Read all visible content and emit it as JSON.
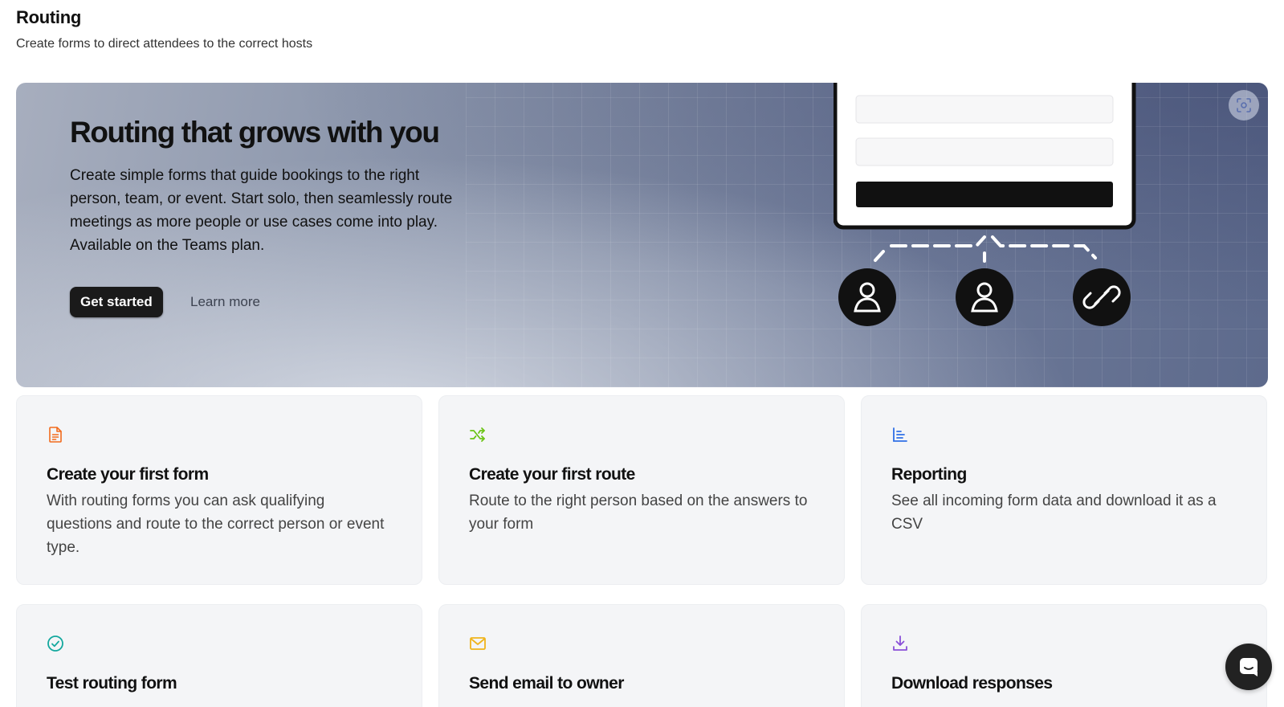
{
  "header": {
    "title": "Routing",
    "subtitle": "Create forms to direct attendees to the correct hosts"
  },
  "hero": {
    "title": "Routing that grows with you",
    "description": "Create simple forms that guide bookings to the right person, team, or event. Start solo, then seamlessly route meetings as more people or use cases come into play. Available on the Teams plan.",
    "primary_button": "Get started",
    "secondary_link": "Learn more",
    "expand_icon": "focus-expand-icon",
    "illustration_icons": [
      "user-icon",
      "user-icon",
      "link-icon"
    ]
  },
  "cards": [
    {
      "icon": "document-icon",
      "icon_color": "#f26b1d",
      "title": "Create your first form",
      "description": "With routing forms you can ask qualifying questions and route to the correct person or event type."
    },
    {
      "icon": "shuffle-icon",
      "icon_color": "#6cc417",
      "title": "Create your first route",
      "description": "Route to the right person based on the answers to your form"
    },
    {
      "icon": "bar-chart-icon",
      "icon_color": "#2f6fe6",
      "title": "Reporting",
      "description": "See all incoming form data and download it as a CSV"
    },
    {
      "icon": "check-circle-icon",
      "icon_color": "#13a89e",
      "title": "Test routing form",
      "description": ""
    },
    {
      "icon": "mail-icon",
      "icon_color": "#f0b41c",
      "title": "Send email to owner",
      "description": ""
    },
    {
      "icon": "download-icon",
      "icon_color": "#8a4fd8",
      "title": "Download responses",
      "description": ""
    }
  ],
  "chat": {
    "icon": "chat-bubble-icon"
  }
}
